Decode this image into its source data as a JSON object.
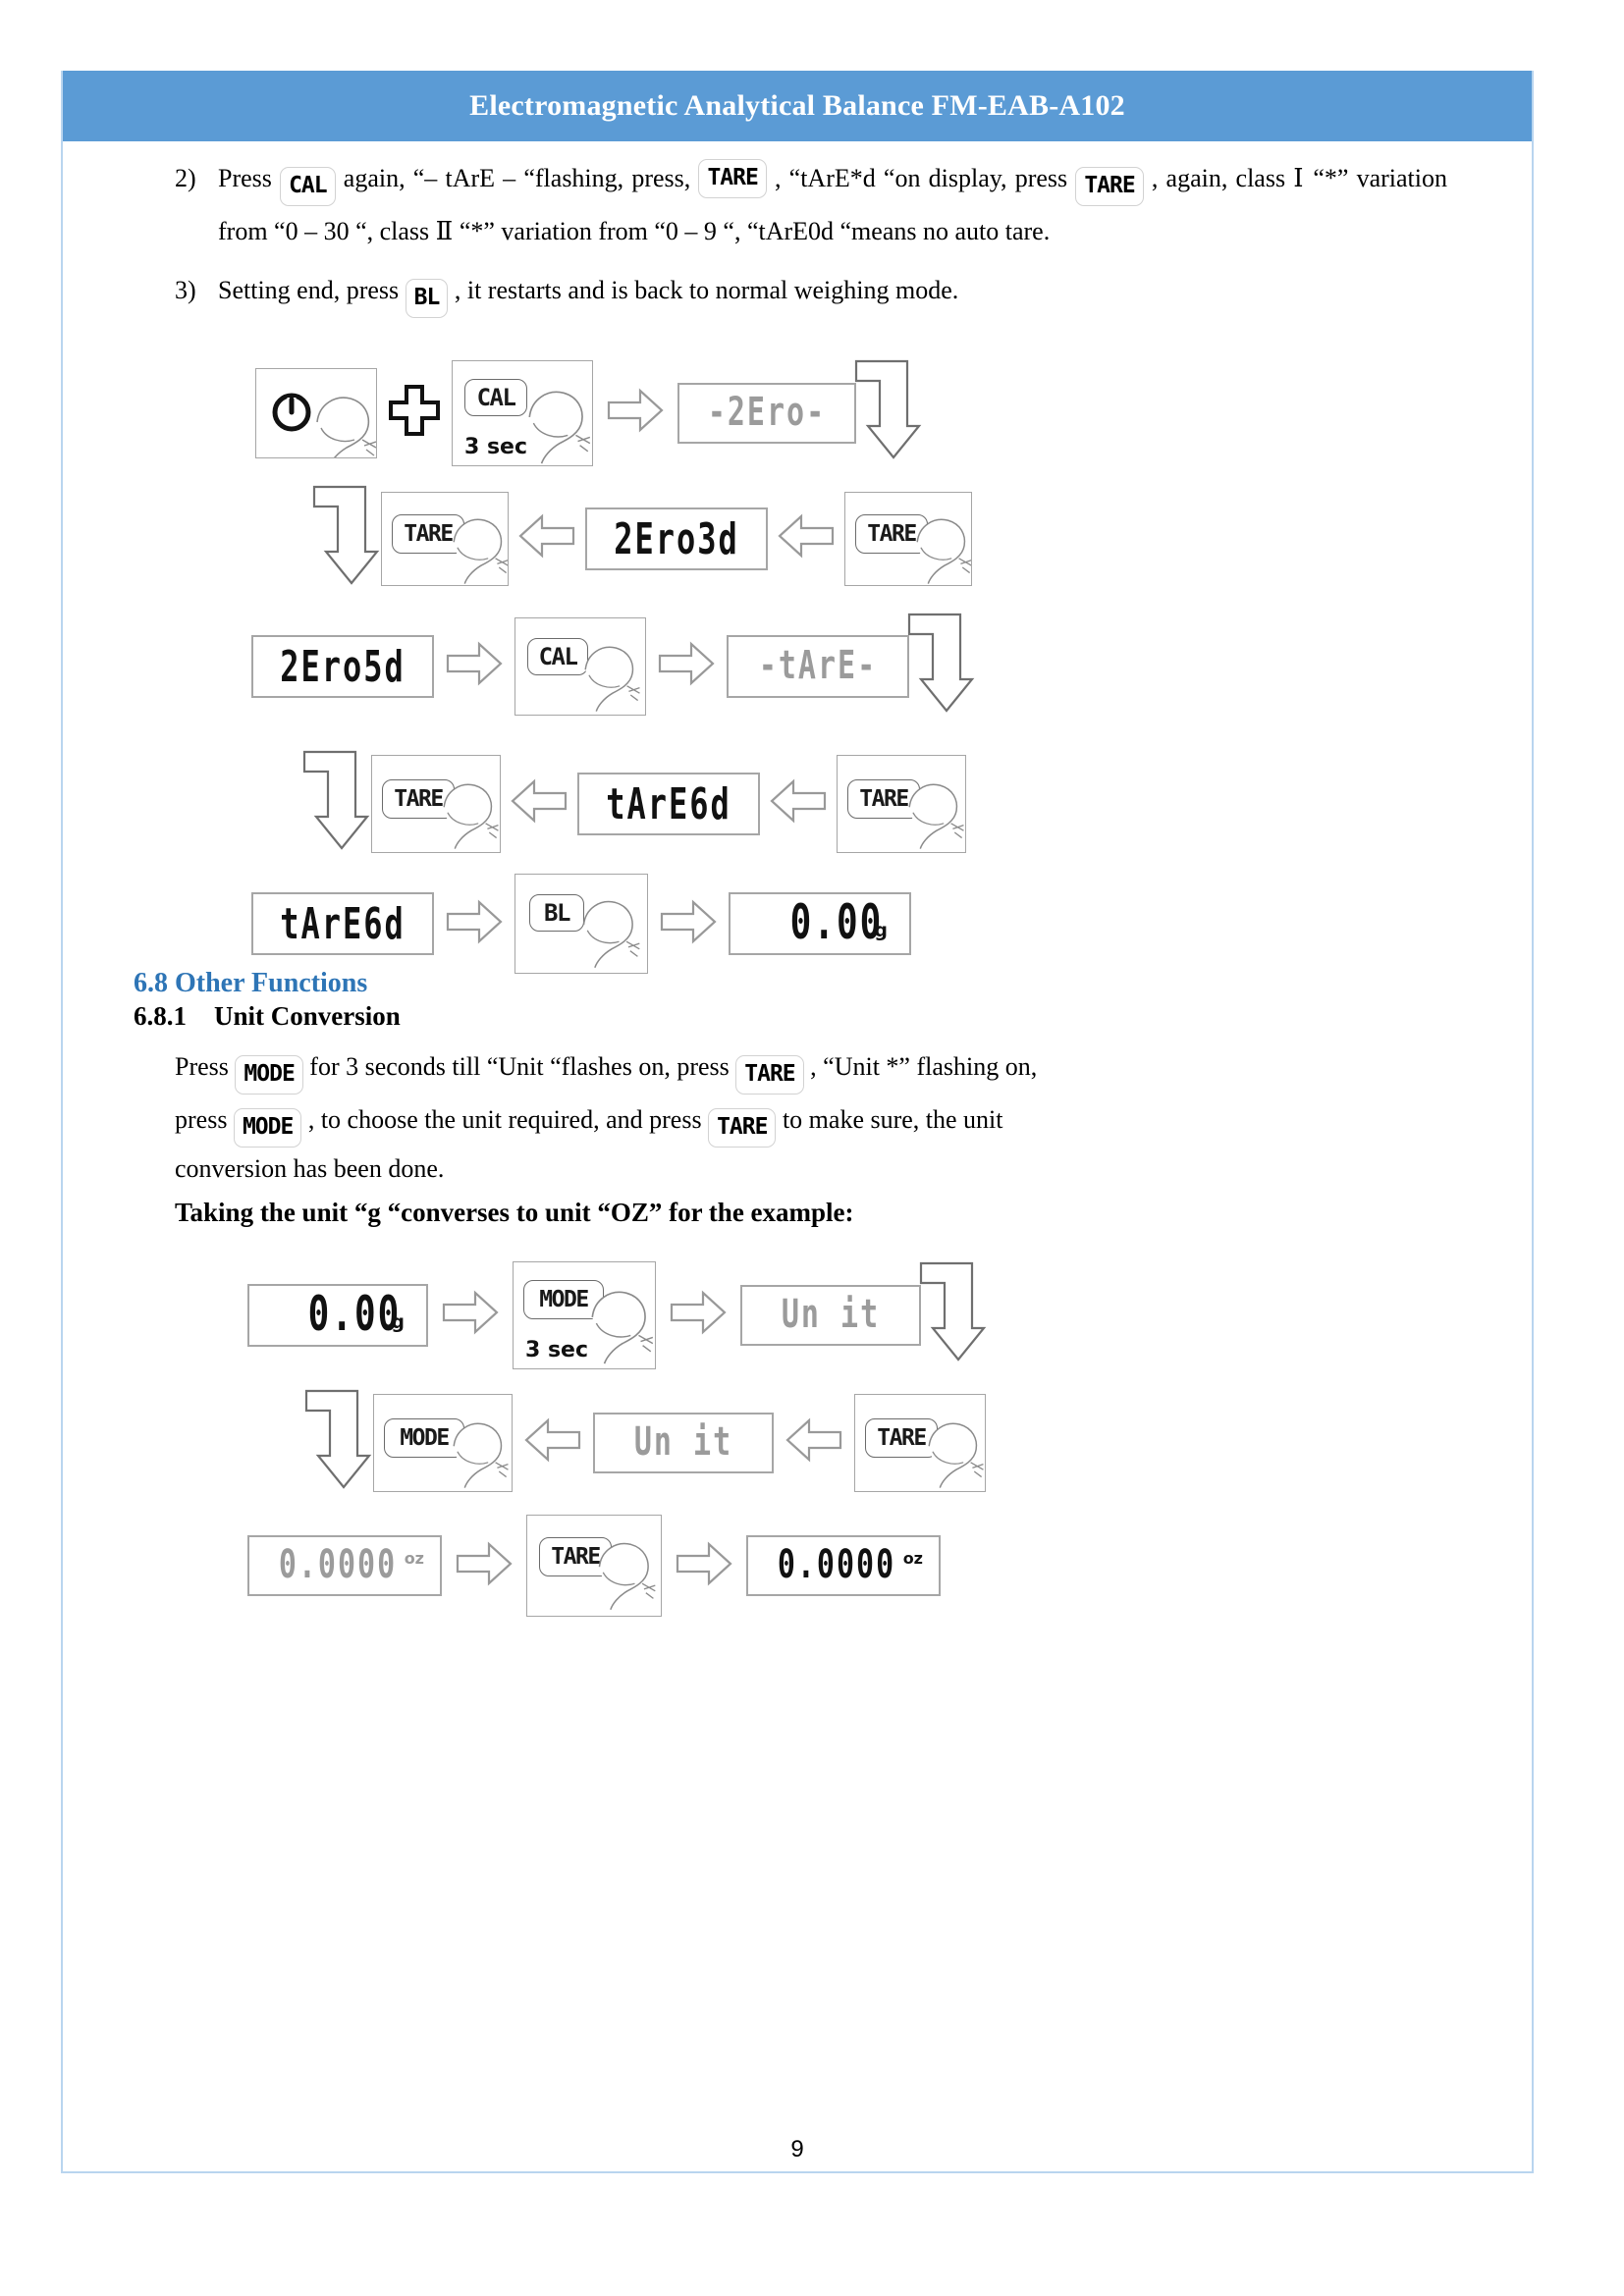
{
  "header": {
    "title": "Electromagnetic Analytical Balance FM-EAB-A102"
  },
  "steps": [
    {
      "num": "2)",
      "seg1": "Press",
      "key1": "CAL",
      "seg2": "again, “– tArE – “flashing, press,",
      "key2": "TARE",
      "seg3": ", “tArE*d “on display, press",
      "key3": "TARE",
      "seg4": ", again, class Ⅰ “*” variation from “0 – 30 “, class Ⅱ “*” variation from “0 – 9 “, “tArE0d “means no auto tare."
    },
    {
      "num": "3)",
      "seg1": "Setting end, press",
      "key1": "BL",
      "seg2": ", it restarts and is back to normal weighing mode."
    }
  ],
  "diagram1": {
    "row1": {
      "power_icon": "power-icon",
      "plus": "plus-icon",
      "key": "CAL",
      "hold": "3 sec",
      "arrow": "arrow-right",
      "lcd": "-2Ero-",
      "lcd_state": "dim",
      "hook": "hook-down"
    },
    "row2": {
      "key_left": "TARE",
      "arrow1": "arrow-left",
      "lcd": "2Ero3d",
      "lcd_state": "on",
      "arrow2": "arrow-left",
      "key_right": "TARE",
      "hook": "hook-down"
    },
    "row3": {
      "lcd": "2Ero5d",
      "lcd_state": "on",
      "arrow1": "arrow-right",
      "key": "CAL",
      "arrow2": "arrow-right",
      "lcd2": "-tArE-",
      "lcd2_state": "dim",
      "hook": "hook-down"
    },
    "row4": {
      "key_left": "TARE",
      "arrow1": "arrow-left",
      "lcd": "tArE6d",
      "lcd_state": "on",
      "arrow2": "arrow-left",
      "key_right": "TARE",
      "hook": "hook-down"
    },
    "row5": {
      "lcd": "tArE6d",
      "lcd_state": "on",
      "arrow1": "arrow-right",
      "key": "BL",
      "arrow2": "arrow-right",
      "lcd2": "0.00",
      "lcd2_unit": "g",
      "lcd2_state": "on"
    }
  },
  "section": {
    "number": "6.8",
    "title": "Other Functions",
    "sub_number": "6.8.1",
    "sub_title": "Unit Conversion",
    "p1_a": "Press",
    "p1_key1": "MODE",
    "p1_b": "for 3 seconds till “Unit “flashes on, press",
    "p1_key2": "TARE",
    "p1_c": ", “Unit *” flashing on,",
    "p2_a": "press",
    "p2_key1": "MODE",
    "p2_b": ", to choose the unit required, and press",
    "p2_key2": "TARE",
    "p2_c": "to make sure, the unit",
    "p3": "conversion has been done.",
    "p4_bold": "Taking the unit “g “converses to unit “OZ” for the example:"
  },
  "diagram2": {
    "row1": {
      "lcd": "0.00",
      "lcd_unit": "g",
      "lcd_state": "on",
      "arrow1": "arrow-right",
      "key": "MODE",
      "hold": "3 sec",
      "arrow2": "arrow-right",
      "lcd2": "Un it",
      "lcd2_state": "dim",
      "hook": "hook-down"
    },
    "row2": {
      "key_left": "MODE",
      "arrow1": "arrow-left",
      "lcd": "Un it",
      "lcd_state": "dim",
      "arrow2": "arrow-left",
      "key_right": "TARE",
      "hook": "hook-down"
    },
    "row3": {
      "lcd": "0.0000",
      "lcd_unit": "oz",
      "lcd_state": "dim",
      "arrow1": "arrow-right",
      "key": "TARE",
      "arrow2": "arrow-right",
      "lcd2": "0.0000",
      "lcd2_unit": "oz",
      "lcd2_state": "on"
    }
  },
  "footer": {
    "page_number": "9"
  }
}
